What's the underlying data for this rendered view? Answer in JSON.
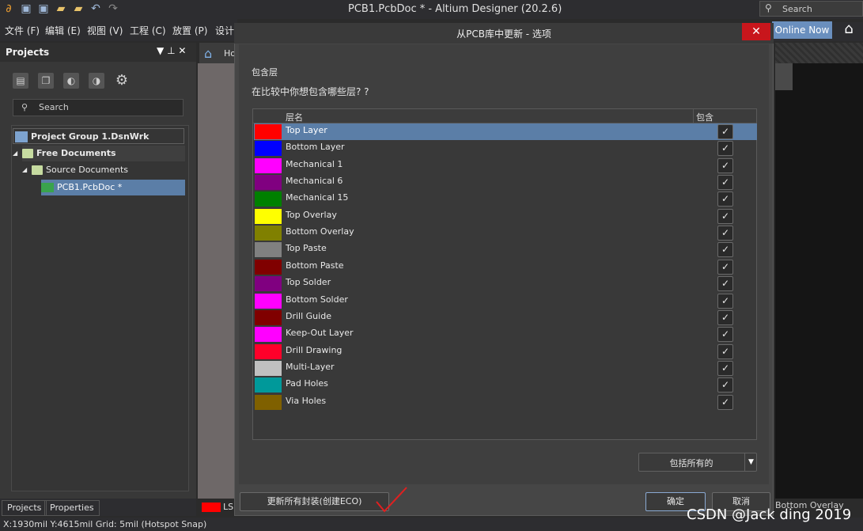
{
  "app": {
    "title": "PCB1.PcbDoc * - Altium Designer (20.2.6)",
    "search_placeholder": "Search",
    "online_label": "Online Now"
  },
  "menu": [
    "文件 (F)",
    "编辑 (E)",
    "视图 (V)",
    "工程 (C)",
    "放置 (P)",
    "设计"
  ],
  "projects_panel": {
    "title": "Projects",
    "search_placeholder": "Search",
    "tree": {
      "group": "Project Group 1.DsnWrk",
      "free_documents": "Free Documents",
      "source_documents": "Source Documents",
      "pcb_doc": "PCB1.PcbDoc *"
    },
    "tabs": [
      "Projects",
      "Properties"
    ]
  },
  "doc_tab": {
    "label": "Ho"
  },
  "layer_tab": {
    "label": "LS",
    "color": "#ff0000"
  },
  "bottom_right_tab": "Bottom Overlay",
  "status_bar": "X:1930mil Y:4615mil    Grid: 5mil      (Hotspot Snap)",
  "watermark": "CSDN @Jack ding 2019",
  "dialog": {
    "title": "从PCB库中更新 - 选项",
    "heading": "包含层",
    "question": "在比较中你想包含哪些层? ?",
    "columns": {
      "name": "层名",
      "include": "包含"
    },
    "layers": [
      {
        "name": "Top Layer",
        "color": "#ff0000",
        "included": true,
        "selected": true
      },
      {
        "name": "Bottom Layer",
        "color": "#0000ff",
        "included": true
      },
      {
        "name": "Mechanical 1",
        "color": "#ff00ff",
        "included": true
      },
      {
        "name": "Mechanical 6",
        "color": "#800080",
        "included": true
      },
      {
        "name": "Mechanical 15",
        "color": "#008000",
        "included": true
      },
      {
        "name": "Top Overlay",
        "color": "#ffff00",
        "included": true
      },
      {
        "name": "Bottom Overlay",
        "color": "#808000",
        "included": true
      },
      {
        "name": "Top Paste",
        "color": "#808080",
        "included": true
      },
      {
        "name": "Bottom Paste",
        "color": "#800000",
        "included": true
      },
      {
        "name": "Top Solder",
        "color": "#800080",
        "included": true
      },
      {
        "name": "Bottom Solder",
        "color": "#ff00ff",
        "included": true
      },
      {
        "name": "Drill Guide",
        "color": "#800000",
        "included": true
      },
      {
        "name": "Keep-Out Layer",
        "color": "#ff00ff",
        "included": true
      },
      {
        "name": "Drill Drawing",
        "color": "#ff002a",
        "included": true
      },
      {
        "name": "Multi-Layer",
        "color": "#c0c0c0",
        "included": true
      },
      {
        "name": "Pad Holes",
        "color": "#00999a",
        "included": true
      },
      {
        "name": "Via Holes",
        "color": "#7f6000",
        "included": true
      }
    ],
    "include_all_label": "包括所有的",
    "update_button": "更新所有封装(创建ECO)",
    "ok_button": "确定",
    "cancel_button": "取消"
  }
}
